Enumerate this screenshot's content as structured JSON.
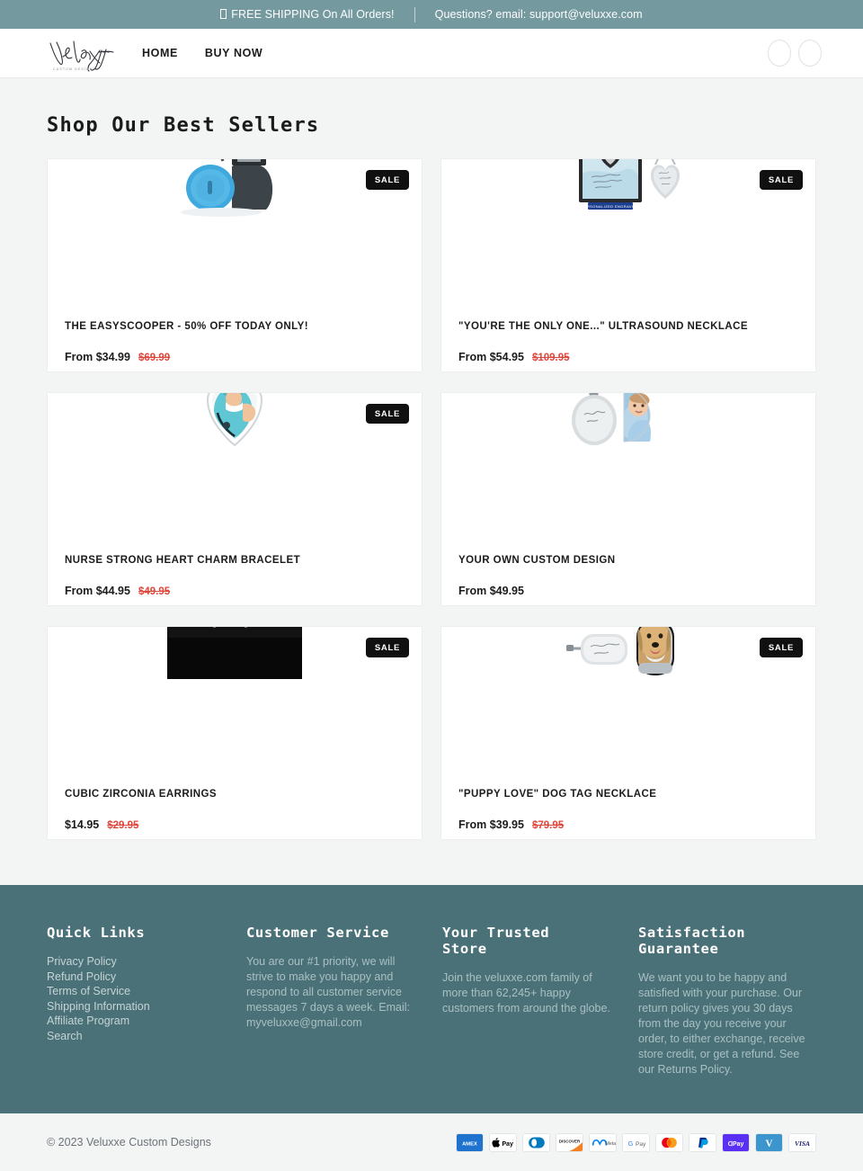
{
  "announcement": {
    "shipping_text": "FREE SHIPPING On All Orders!",
    "support_text": "Questions? email: support@veluxxe.com"
  },
  "header": {
    "logo_text": "Veluxxe",
    "logo_subtext": "CUSTOM DESIGNS",
    "nav": [
      {
        "label": "HOME"
      },
      {
        "label": "BUY NOW"
      }
    ]
  },
  "main": {
    "title": "Shop Our Best Sellers",
    "sale_badge": "SALE",
    "products": [
      {
        "title": "THE EASYSCOOPER - 50% OFF TODAY ONLY!",
        "price": "From $34.99",
        "compare_price": "$69.99",
        "on_sale": true
      },
      {
        "title": "\"YOU'RE THE ONLY ONE...\" ULTRASOUND NECKLACE",
        "price": "From $54.95",
        "compare_price": "$109.95",
        "on_sale": true
      },
      {
        "title": "NURSE STRONG HEART CHARM BRACELET",
        "price": "From $44.95",
        "compare_price": "$49.95",
        "on_sale": true
      },
      {
        "title": "YOUR OWN CUSTOM DESIGN",
        "price": "From $49.95",
        "compare_price": "",
        "on_sale": false
      },
      {
        "title": "CUBIC ZIRCONIA EARRINGS",
        "price": "$14.95",
        "compare_price": "$29.95",
        "on_sale": true
      },
      {
        "title": "\"PUPPY LOVE\" DOG TAG NECKLACE",
        "price": "From $39.95",
        "compare_price": "$79.95",
        "on_sale": true
      }
    ]
  },
  "footer": {
    "quick_links": {
      "title": "Quick Links",
      "items": [
        {
          "label": "Privacy Policy"
        },
        {
          "label": "Refund Policy"
        },
        {
          "label": "Terms of Service"
        },
        {
          "label": "Shipping Information"
        },
        {
          "label": "Affiliate Program"
        },
        {
          "label": "Search"
        }
      ]
    },
    "customer_service": {
      "title": "Customer Service",
      "body": "You are our #1 priority, we will strive to make you happy and respond to all customer service messages 7 days a week. Email: myveluxxe@gmail.com"
    },
    "trusted_store": {
      "title": "Your Trusted Store",
      "body": "Join the veluxxe.com family of more than 62,245+ happy customers from around the globe."
    },
    "satisfaction": {
      "title": "Satisfaction Guarantee",
      "body": "We want you to be happy and satisfied with your purchase. Our return policy gives you 30 days from the day you receive your order, to either exchange, receive store credit, or get a refund. See our Returns Policy."
    }
  },
  "bottom": {
    "copyright": "© 2023 Veluxxe Custom Designs",
    "payment_methods": [
      {
        "name": "amex-icon",
        "label": "AMEX"
      },
      {
        "name": "apple-pay-icon",
        "label": "Apple Pay"
      },
      {
        "name": "diners-club-icon",
        "label": "Diners Club"
      },
      {
        "name": "discover-icon",
        "label": "DISCOVER"
      },
      {
        "name": "meta-pay-icon",
        "label": "Meta Pay"
      },
      {
        "name": "google-pay-icon",
        "label": "G Pay"
      },
      {
        "name": "mastercard-icon",
        "label": "Mastercard"
      },
      {
        "name": "paypal-icon",
        "label": "PayPal"
      },
      {
        "name": "shop-pay-icon",
        "label": "Shop Pay"
      },
      {
        "name": "venmo-icon",
        "label": "Venmo"
      },
      {
        "name": "visa-icon",
        "label": "VISA"
      }
    ]
  },
  "colors": {
    "announcement_bg": "#74999e",
    "footer_bg": "#4a7177",
    "page_bg": "#f3f5f5",
    "sale_badge_bg": "#101010",
    "compare_price": "#e1463c"
  }
}
